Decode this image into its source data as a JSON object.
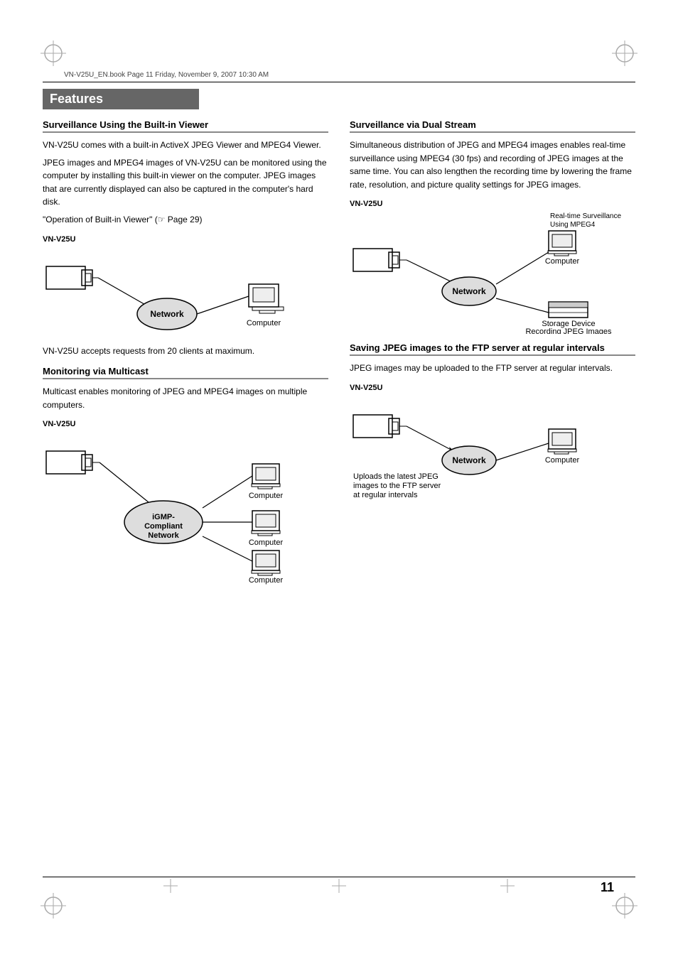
{
  "page": {
    "number": "11",
    "header_text": "VN-V25U_EN.book  Page 11  Friday, November 9, 2007  10:30 AM"
  },
  "section": {
    "title": "Features"
  },
  "left_column": {
    "subsection1": {
      "heading": "Surveillance Using the Built-in Viewer",
      "paragraphs": [
        "VN-V25U comes with a built-in ActiveX JPEG Viewer and MPEG4 Viewer.",
        "JPEG images and MPEG4 images of VN-V25U can be monitored using the computer by installing this built-in viewer on the computer. JPEG images that are currently displayed can also be captured in the computer's hard disk.",
        "\"Operation of Built-in Viewer\" (☞ Page 29)"
      ],
      "diagram": {
        "camera_label": "VN-V25U",
        "network_label": "Network",
        "computer_label": "Computer"
      },
      "caption": "VN-V25U accepts requests from 20 clients at maximum."
    },
    "subsection2": {
      "heading": "Monitoring via Multicast",
      "paragraph": "Multicast enables monitoring of JPEG and MPEG4 images on multiple computers.",
      "diagram": {
        "camera_label": "VN-V25U",
        "network_label": "iGMP-Compliant Network",
        "computer_labels": [
          "Computer",
          "Computer",
          "Computer"
        ]
      }
    }
  },
  "right_column": {
    "subsection1": {
      "heading": "Surveillance via Dual Stream",
      "paragraph": "Simultaneous distribution of JPEG and MPEG4 images enables real-time surveillance using MPEG4 (30 fps) and recording of JPEG images at the same time. You can also lengthen the recording time by lowering the frame rate, resolution, and picture quality settings for JPEG images.",
      "diagram": {
        "camera_label": "VN-V25U",
        "network_label": "Network",
        "realtime_label": "Real-time Surveillance Using MPEG4",
        "computer_label": "Computer",
        "storage_label": "Storage Device",
        "recording_label": "Recording JPEG Images"
      }
    },
    "subsection2": {
      "heading": "Saving JPEG images to the FTP server at regular intervals",
      "paragraph": "JPEG images may be uploaded to the FTP server at regular intervals.",
      "diagram": {
        "camera_label": "VN-V25U",
        "network_label": "Network",
        "computer_label": "Computer",
        "upload_caption": "Uploads the latest JPEG images to the FTP server at regular intervals"
      }
    }
  }
}
